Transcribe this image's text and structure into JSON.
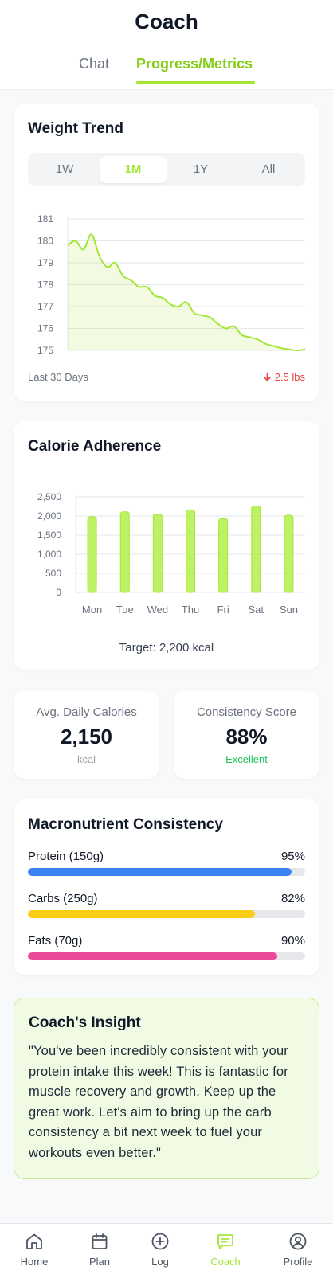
{
  "header": {
    "title": "Coach",
    "tabs": [
      {
        "label": "Chat",
        "active": false
      },
      {
        "label": "Progress/Metrics",
        "active": true
      }
    ]
  },
  "weight_trend": {
    "title": "Weight Trend",
    "ranges": [
      "1W",
      "1M",
      "1Y",
      "All"
    ],
    "selected_range": "1M",
    "footer_left": "Last 30 Days",
    "footer_right": "2.5 lbs",
    "change_direction": "down",
    "chart_data": {
      "type": "area",
      "x": [
        0,
        1,
        2,
        3,
        4,
        5,
        6,
        7,
        8,
        9,
        10,
        11,
        12,
        13,
        14,
        15,
        16,
        17,
        18,
        19,
        20,
        21,
        22,
        23,
        24,
        25,
        26,
        27,
        28,
        29,
        30
      ],
      "values": [
        179.8,
        180.0,
        179.6,
        180.3,
        179.3,
        178.8,
        179.0,
        178.4,
        178.2,
        177.9,
        177.9,
        177.5,
        177.4,
        177.1,
        177.0,
        177.2,
        176.7,
        176.6,
        176.5,
        176.2,
        176.0,
        176.1,
        175.7,
        175.6,
        175.5,
        175.3,
        175.2,
        175.1,
        175.05,
        175.0,
        175.05
      ],
      "yticks": [
        181,
        180,
        179,
        178,
        177,
        176,
        175
      ],
      "ylim": [
        175,
        181
      ],
      "grid": true,
      "color": "#a3e635"
    }
  },
  "calorie_adherence": {
    "title": "Calorie Adherence",
    "target_label": "Target: 2,200 kcal",
    "chart_data": {
      "type": "bar",
      "categories": [
        "Mon",
        "Tue",
        "Wed",
        "Thu",
        "Fri",
        "Sat",
        "Sun"
      ],
      "values": [
        1980,
        2110,
        2050,
        2160,
        1930,
        2260,
        2020
      ],
      "yticks": [
        2500,
        2000,
        1500,
        1000,
        500,
        0
      ],
      "ytick_labels": [
        "2,500",
        "2,000",
        "1,500",
        "1,000",
        "500",
        "0"
      ],
      "ylim": [
        0,
        2500
      ],
      "grid": true,
      "color": "#bef264"
    }
  },
  "stats": [
    {
      "label": "Avg. Daily Calories",
      "value": "2,150",
      "sub": "kcal"
    },
    {
      "label": "Consistency Score",
      "value": "88%",
      "sub": "Excellent"
    }
  ],
  "macros": {
    "title": "Macronutrient Consistency",
    "items": [
      {
        "name": "Protein (150g)",
        "percent_label": "95%",
        "percent": 95,
        "color": "#3b82f6"
      },
      {
        "name": "Carbs (250g)",
        "percent_label": "82%",
        "percent": 82,
        "color": "#facc15"
      },
      {
        "name": "Fats (70g)",
        "percent_label": "90%",
        "percent": 90,
        "color": "#ec4899"
      }
    ]
  },
  "insight": {
    "title": "Coach's Insight",
    "text": "\"You've been incredibly consistent with your protein intake this week! This is fantastic for muscle recovery and growth. Keep up the great work. Let's aim to bring up the carb consistency a bit next week to fuel your workouts even better.\""
  },
  "nav": {
    "items": [
      {
        "label": "Home",
        "icon": "home-icon"
      },
      {
        "label": "Plan",
        "icon": "calendar-icon"
      },
      {
        "label": "Log",
        "icon": "plus-circle-icon"
      },
      {
        "label": "Coach",
        "icon": "chat-icon",
        "active": true
      },
      {
        "label": "Profile",
        "icon": "user-circle-icon"
      }
    ]
  },
  "colors": {
    "accent": "#a3e635",
    "danger": "#ef4444",
    "success": "#22c55e"
  }
}
